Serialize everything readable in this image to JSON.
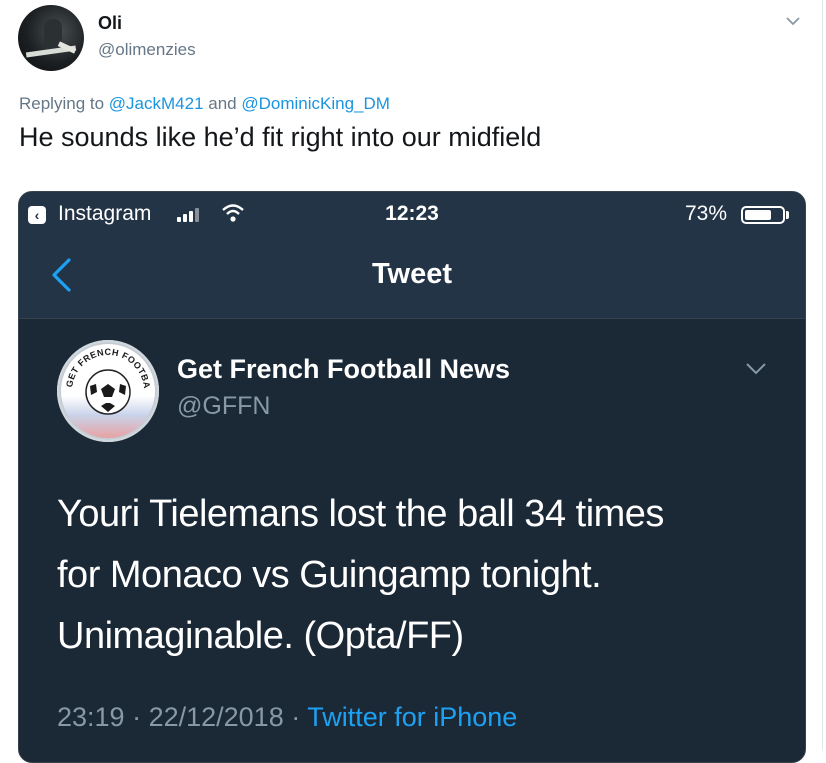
{
  "outer_tweet": {
    "author_name": "Oli",
    "author_handle": "@olimenzies",
    "replying_prefix": "Replying to ",
    "mention_1": "@JackM421",
    "replying_and": " and ",
    "mention_2": "@DominicKing_DM",
    "text": "He sounds like he’d fit right into our midfield"
  },
  "screenshot": {
    "status_bar": {
      "back_app": "Instagram",
      "time": "12:23",
      "battery_percent": "73%",
      "battery_level": 0.73
    },
    "nav_title": "Tweet",
    "quoted_tweet": {
      "author_name": "Get French Football News",
      "author_handle": "@GFFN",
      "avatar_logo_text": "GET FRENCH FOOTBALL NEWS",
      "text_line_1": "Youri Tielemans lost the ball 34 times",
      "text_line_2": "for Monaco vs Guingamp tonight.",
      "text_line_3": "Unimaginable. (Opta/FF)",
      "time": "23:19",
      "sep_1": " · ",
      "date": "22/12/2018",
      "sep_2": " · ",
      "source": "Twitter for iPhone"
    }
  },
  "colors": {
    "link": "#1b95e0",
    "dark_bg": "#1b2836",
    "dark_header": "#243447",
    "muted": "#8899a6",
    "accent": "#1da1f2"
  },
  "icons": [
    "chevron-down-icon",
    "instagram-back-icon",
    "signal-icon",
    "wifi-icon",
    "battery-icon",
    "back-chevron-icon",
    "soccer-ball-logo"
  ]
}
